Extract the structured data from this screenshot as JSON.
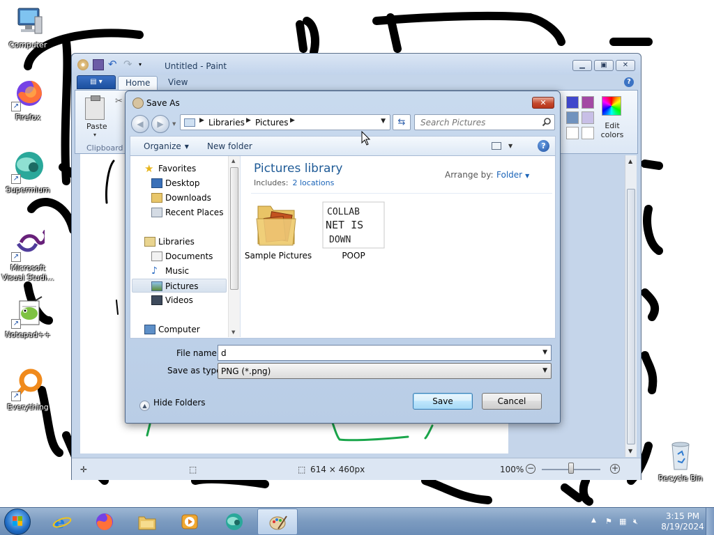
{
  "desktop": {
    "icons": [
      {
        "label": "Computer",
        "icon": "computer-icon"
      },
      {
        "label": "Firefox",
        "icon": "firefox-icon"
      },
      {
        "label": "Supermium",
        "icon": "supermium-icon"
      },
      {
        "label": "Microsoft Visual Studi...",
        "icon": "visual-studio-icon"
      },
      {
        "label": "Notepad++",
        "icon": "notepadpp-icon"
      },
      {
        "label": "Everything",
        "icon": "everything-icon"
      },
      {
        "label": "Recycle Bin",
        "icon": "recycle-bin-icon"
      }
    ]
  },
  "paint": {
    "title": "Untitled - Paint",
    "tabs": [
      "Home",
      "View"
    ],
    "ribbon": {
      "paste_label": "Paste",
      "clipboard_label": "Clipboard",
      "edit_colors_label": "Edit colors"
    },
    "status": {
      "canvas_size": "614 × 460px",
      "zoom": "100%"
    }
  },
  "dialog": {
    "title": "Save As",
    "address": [
      "Libraries",
      "Pictures"
    ],
    "search_placeholder": "Search Pictures",
    "toolbar": {
      "organize": "Organize",
      "new_folder": "New folder"
    },
    "nav": {
      "favorites": "Favorites",
      "desktop": "Desktop",
      "downloads": "Downloads",
      "recent_places": "Recent Places",
      "libraries": "Libraries",
      "documents": "Documents",
      "music": "Music",
      "pictures": "Pictures",
      "videos": "Videos",
      "computer": "Computer"
    },
    "library": {
      "title": "Pictures library",
      "includes_label": "Includes:",
      "locations": "2 locations",
      "arrange_label": "Arrange by:",
      "arrange_value": "Folder"
    },
    "files": [
      {
        "name": "Sample Pictures",
        "icon": "folder-icon"
      },
      {
        "name": "POOP",
        "icon": "image-thumbnail-icon",
        "thumb_text": [
          "COLLAB",
          "NET IS",
          "DOWN"
        ]
      }
    ],
    "file_name_label": "File name:",
    "file_name_value": "d",
    "save_type_label": "Save as type:",
    "save_type_value": "PNG (*.png)",
    "hide_folders": "Hide Folders",
    "save": "Save",
    "cancel": "Cancel"
  },
  "taskbar": {
    "apps": [
      "start",
      "internet-explorer",
      "firefox",
      "windows-explorer",
      "media-player",
      "supermium",
      "paint"
    ],
    "active_app": "paint",
    "time": "3:15 PM",
    "date": "8/19/2024"
  },
  "colors": {
    "accent": "#1e5a96",
    "link": "#1b64b8",
    "close_red": "#c4492d"
  }
}
